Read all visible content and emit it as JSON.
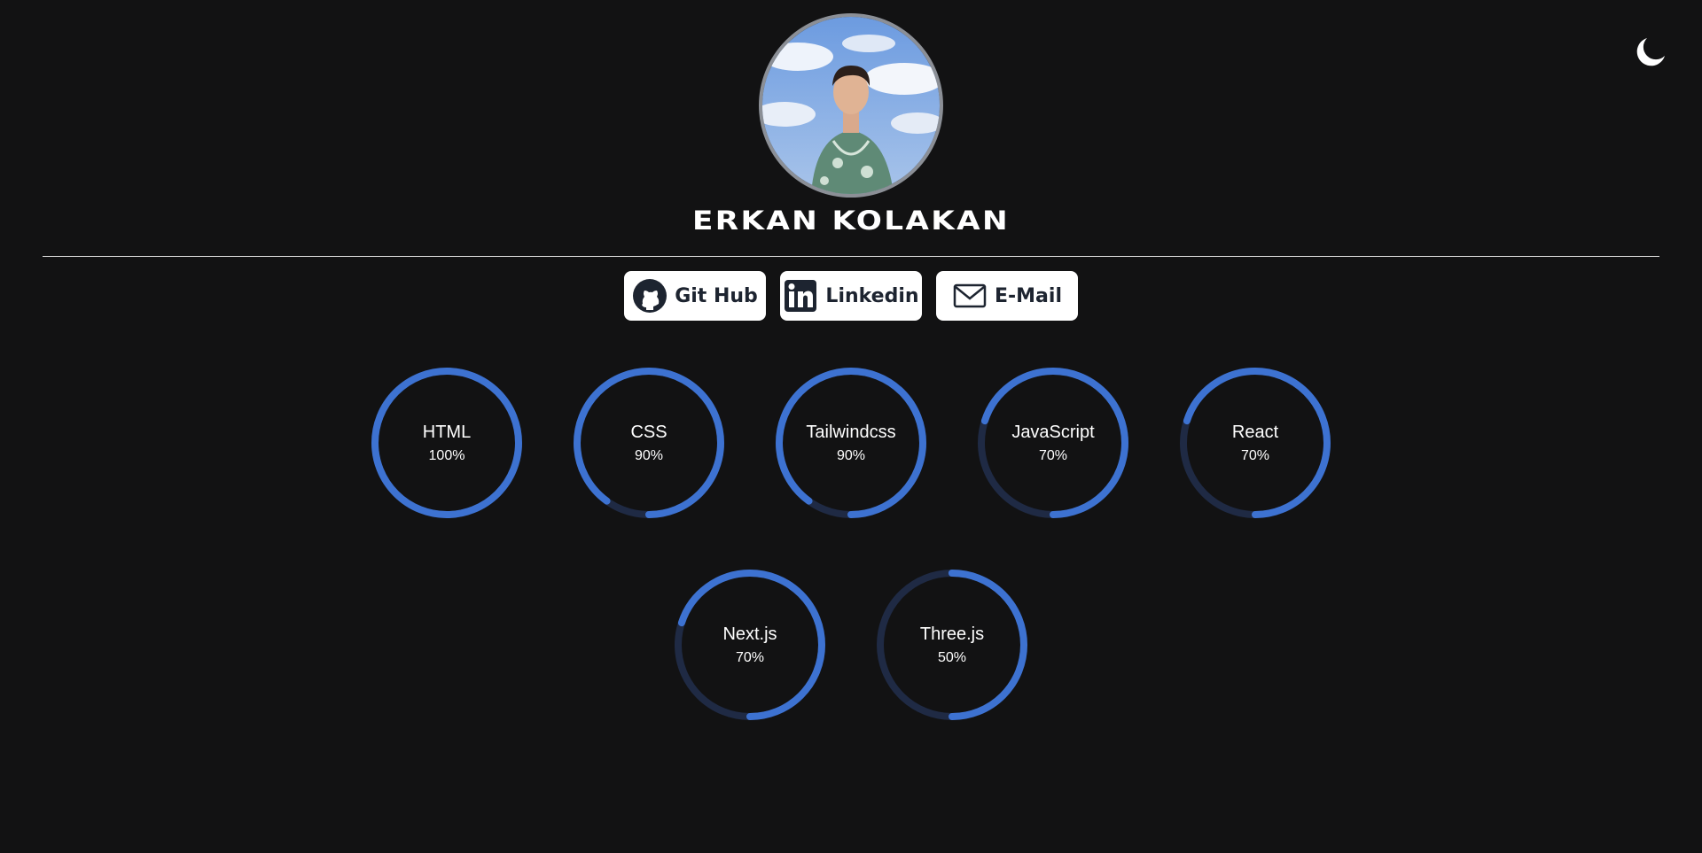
{
  "profile": {
    "name": "ERKAN KOLAKAN"
  },
  "social": [
    {
      "label": "Git Hub",
      "icon": "github-icon"
    },
    {
      "label": "Linkedin",
      "icon": "linkedin-icon"
    },
    {
      "label": "E-Mail",
      "icon": "email-icon"
    }
  ],
  "skills": [
    {
      "name": "HTML",
      "percent_label": "100%",
      "percent": 100
    },
    {
      "name": "CSS",
      "percent_label": "90%",
      "percent": 90
    },
    {
      "name": "Tailwindcss",
      "percent_label": "90%",
      "percent": 90
    },
    {
      "name": "JavaScript",
      "percent_label": "70%",
      "percent": 70
    },
    {
      "name": "React",
      "percent_label": "70%",
      "percent": 70
    },
    {
      "name": "Next.js",
      "percent_label": "70%",
      "percent": 70
    },
    {
      "name": "Three.js",
      "percent_label": "50%",
      "percent": 50
    }
  ],
  "theme": {
    "toggle_icon": "moon-icon",
    "background": "#121213",
    "ring_color": "#3d72d1",
    "ring_track": "#1f2a44",
    "button_bg": "#ffffff",
    "button_text": "#1d2430"
  }
}
